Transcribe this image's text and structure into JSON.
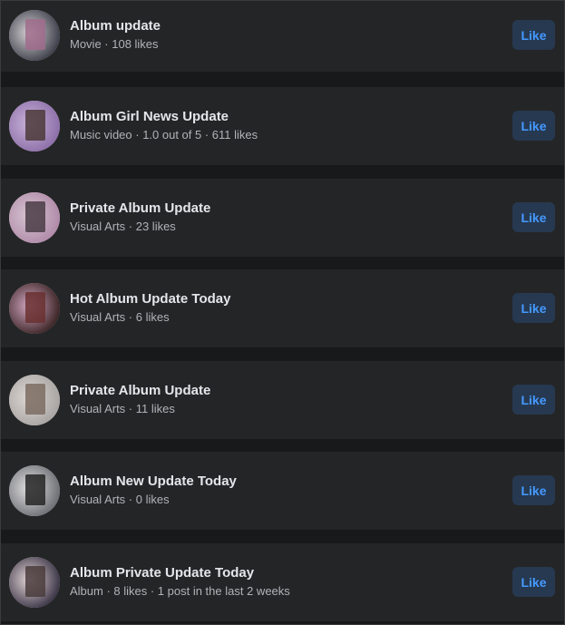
{
  "pages": [
    {
      "title": "Album update",
      "meta": "Movie · 108 likes",
      "like_label": "Like",
      "avatar_colors": [
        "#3c3f4a",
        "#d8d2d6",
        "#a06c8c"
      ]
    },
    {
      "title": "Album Girl News Update",
      "meta": "Music video · 1.0 out of 5 · 611 likes",
      "like_label": "Like",
      "avatar_colors": [
        "#8c6fa8",
        "#c9b3d9",
        "#4b3a3a"
      ]
    },
    {
      "title": "Private Album Update",
      "meta": "Visual Arts · 23 likes",
      "like_label": "Like",
      "avatar_colors": [
        "#b08aa8",
        "#d7c6d2",
        "#4a3c46"
      ]
    },
    {
      "title": "Hot Album Update Today",
      "meta": "Visual Arts · 6 likes",
      "like_label": "Like",
      "avatar_colors": [
        "#3a2424",
        "#d4a8c4",
        "#6a3030"
      ]
    },
    {
      "title": "Private Album Update",
      "meta": "Visual Arts · 11 likes",
      "like_label": "Like",
      "avatar_colors": [
        "#a8a4a2",
        "#ded8d4",
        "#7c6c62"
      ]
    },
    {
      "title": "Album New Update Today",
      "meta": "Visual Arts · 0 likes",
      "like_label": "Like",
      "avatar_colors": [
        "#6c6e74",
        "#e4e2e2",
        "#242424"
      ]
    },
    {
      "title": "Album Private Update Today",
      "meta": "Album · 8 likes · 1 post in the last 2 weeks",
      "like_label": "Like",
      "avatar_colors": [
        "#3a3446",
        "#e6d8d8",
        "#4a3c3c"
      ]
    }
  ]
}
